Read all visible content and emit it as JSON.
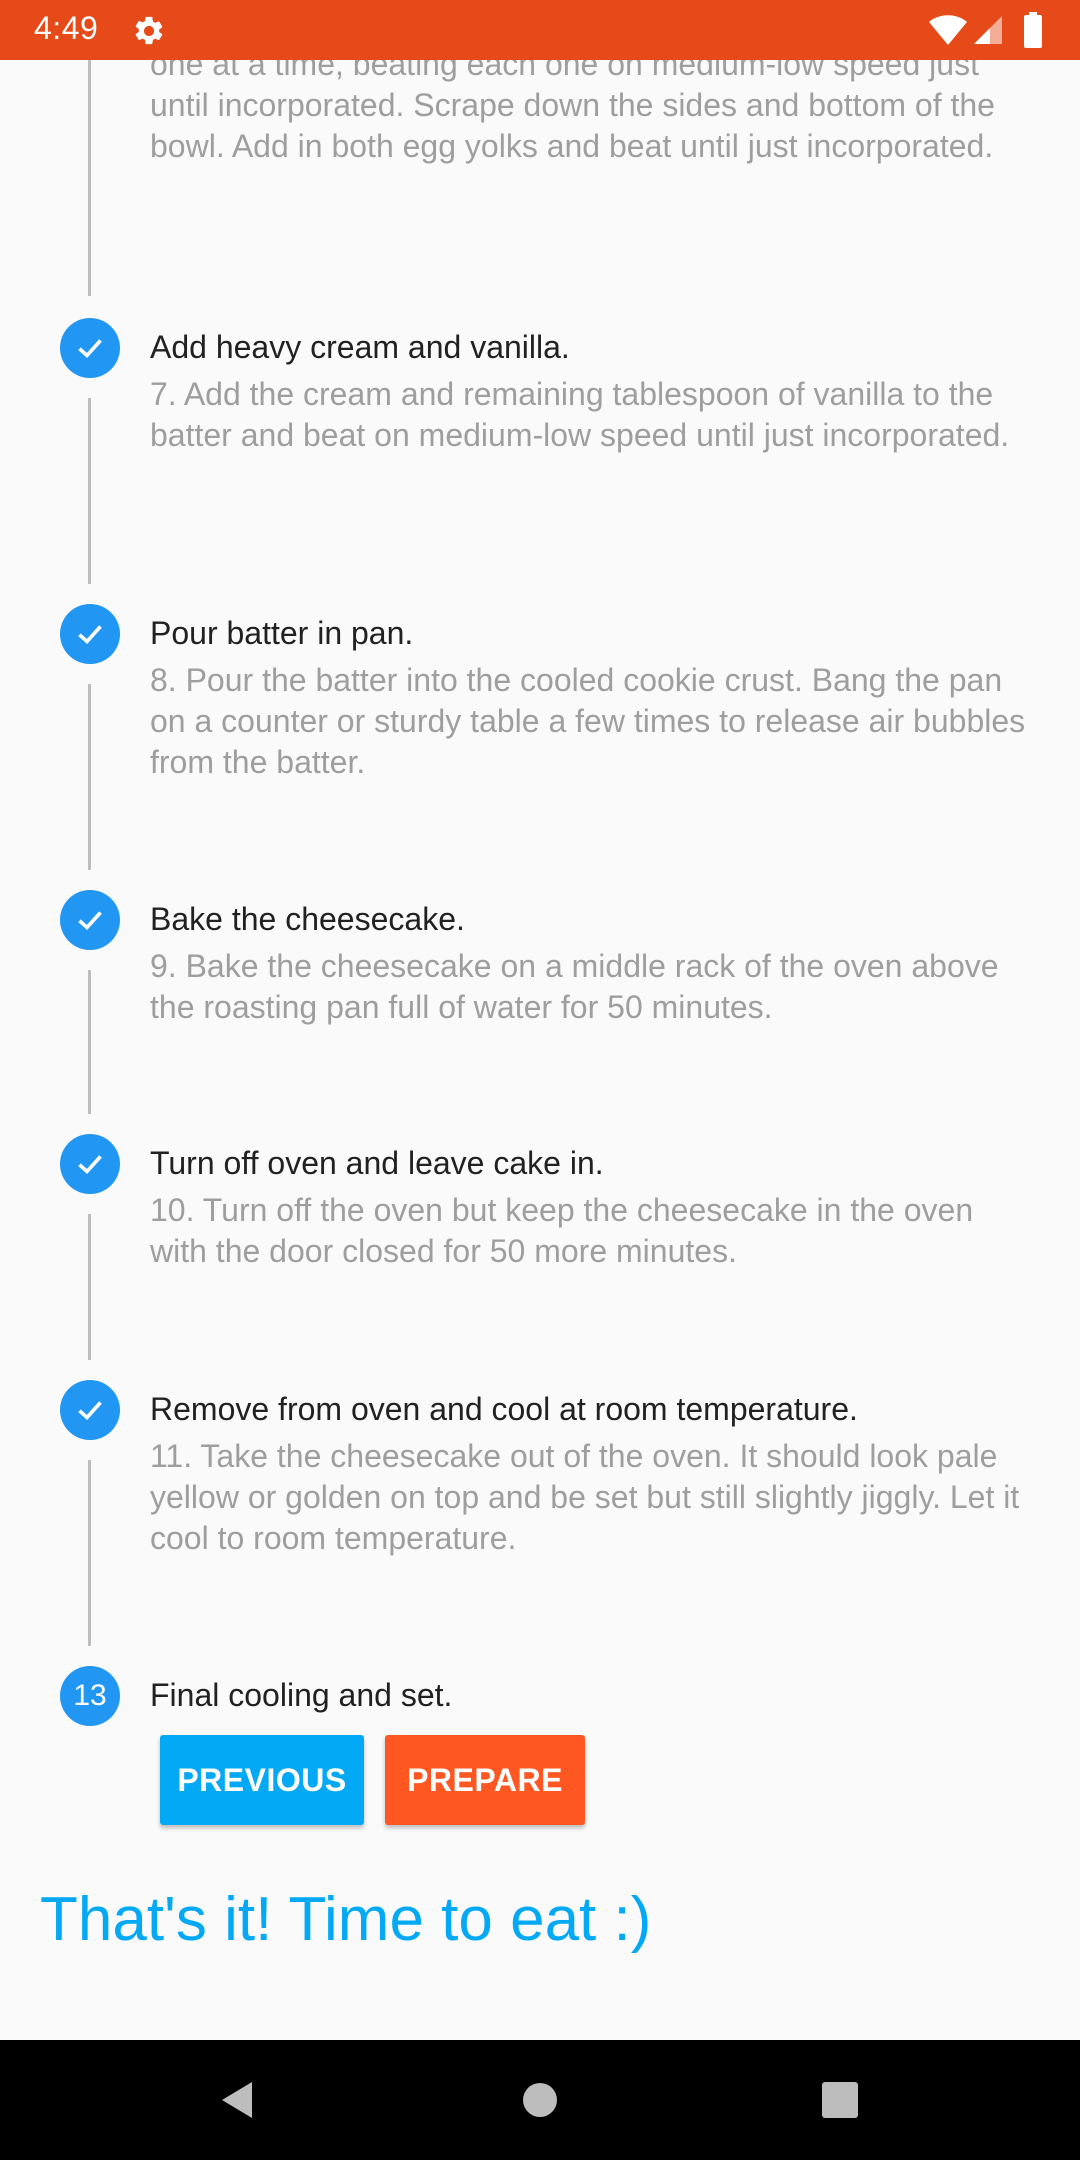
{
  "status_bar": {
    "time": "4:49",
    "background": "#e64a19",
    "icons": [
      "gear-icon",
      "wifi-icon",
      "cell-signal-icon",
      "battery-icon"
    ]
  },
  "previous_step_text": "one at a time, beating each one on medium-low speed just until incorporated. Scrape down the sides and bottom of the bowl. Add in both egg yolks and beat until just incorporated.",
  "steps": [
    {
      "title": "Add heavy cream and vanilla.",
      "description": "7. Add the cream and remaining tablespoon of vanilla to the batter and beat on medium-low speed until just incorporated.",
      "status": "completed"
    },
    {
      "title": "Pour batter in pan.",
      "description": "8. Pour the batter into the cooled cookie crust. Bang the pan on a counter or sturdy table a few times to release air bubbles from the batter.",
      "status": "completed"
    },
    {
      "title": "Bake the cheesecake.",
      "description": "9. Bake the cheesecake on a middle rack of the oven above the roasting pan full of water for 50 minutes.",
      "status": "completed"
    },
    {
      "title": "Turn off oven and leave cake in.",
      "description": "10. Turn off the oven but keep the cheesecake in the oven with the door closed for 50 more minutes.",
      "status": "completed"
    },
    {
      "title": "Remove from oven and cool at room temperature.",
      "description": "11. Take the cheesecake out of the oven. It should look pale yellow or golden on top and be set but still slightly jiggly. Let it cool to room temperature.",
      "status": "completed"
    },
    {
      "number": "13",
      "title": "Final cooling and set.",
      "status": "active"
    }
  ],
  "buttons": {
    "previous": "PREVIOUS",
    "prepare": "PREPARE"
  },
  "final_message": "That's it! Time to eat :)",
  "colors": {
    "accent": "#2196f3",
    "previous_button": "#03a9f4",
    "prepare_button": "#ff5722",
    "final_text": "#03a9f4"
  },
  "nav_bar": {
    "icons": [
      "back-icon",
      "home-icon",
      "recents-icon"
    ]
  }
}
